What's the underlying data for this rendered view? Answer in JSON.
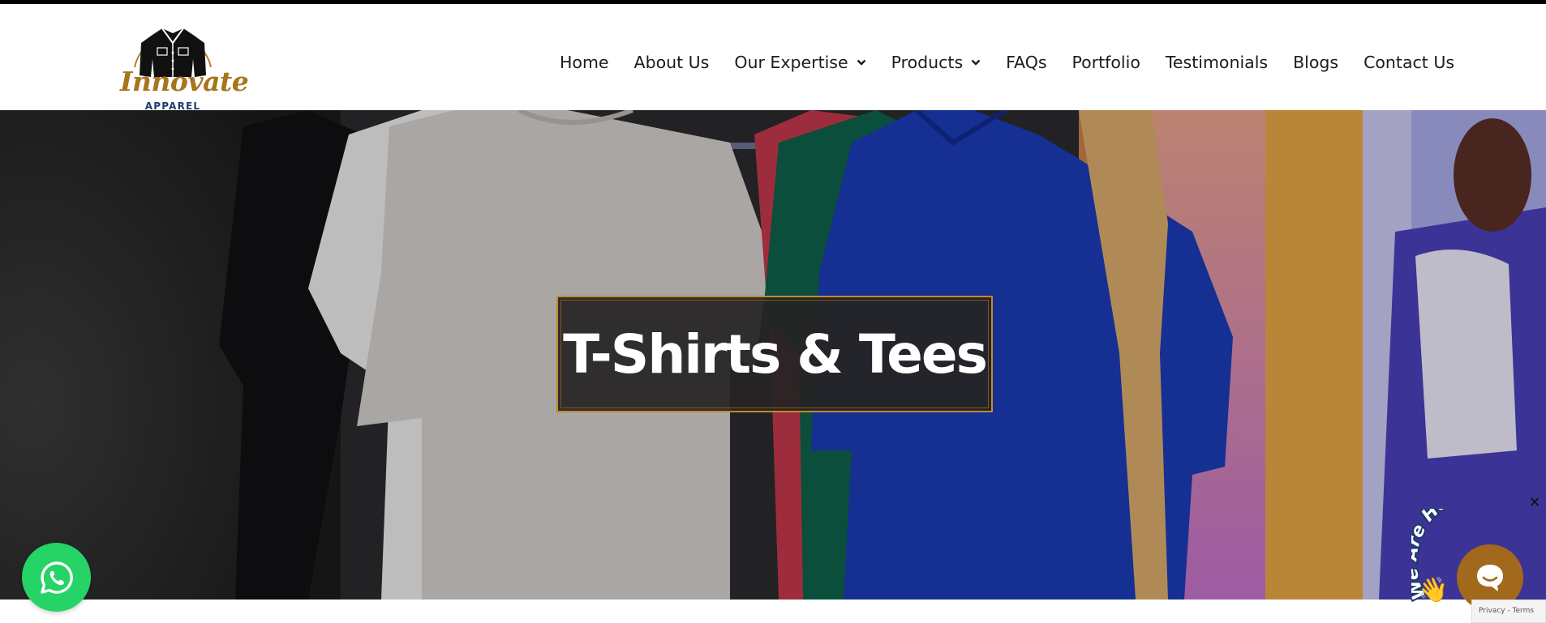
{
  "brand": {
    "name": "Innovate",
    "sub": "APPAREL",
    "colors": {
      "gold": "#a8741c",
      "navy": "#1f3a70"
    }
  },
  "nav": {
    "items": [
      {
        "label": "Home",
        "has_dropdown": false
      },
      {
        "label": "About Us",
        "has_dropdown": false
      },
      {
        "label": "Our Expertise",
        "has_dropdown": true
      },
      {
        "label": "Products",
        "has_dropdown": true
      },
      {
        "label": "FAQs",
        "has_dropdown": false
      },
      {
        "label": "Portfolio",
        "has_dropdown": false
      },
      {
        "label": "Testimonials",
        "has_dropdown": false
      },
      {
        "label": "Blogs",
        "has_dropdown": false
      },
      {
        "label": "Contact Us",
        "has_dropdown": false
      }
    ]
  },
  "hero": {
    "title": "T-Shirts & Tees",
    "accent": "#c58a2a"
  },
  "widgets": {
    "whatsapp_icon": "whatsapp-icon",
    "chat_badge": "We Are Here!",
    "close": "✕",
    "recaptcha": "Privacy - Terms",
    "colors": {
      "whatsapp": "#25d366",
      "chat": "#a2691c"
    }
  }
}
